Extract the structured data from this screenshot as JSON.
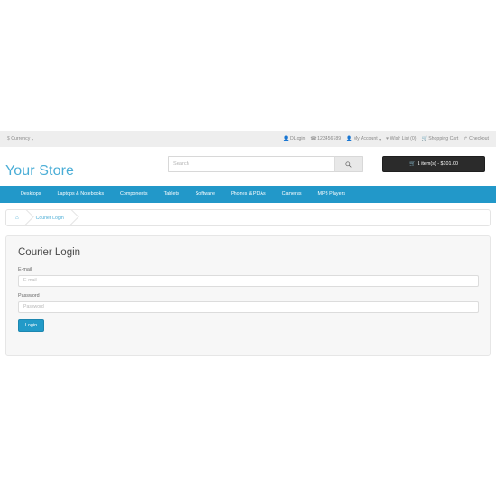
{
  "colors": {
    "brand_blue": "#2298c9",
    "logo_blue": "#4aadd6",
    "button_blue": "#229ac8",
    "topbar_gray": "#eeeeee",
    "cart_dark": "#2b2b2b",
    "panel_gray": "#f7f7f7"
  },
  "topbar": {
    "currency": {
      "symbol": "$",
      "label": "Currency",
      "caret": "▾"
    },
    "links": [
      {
        "icon": "user-icon",
        "glyph": "👤",
        "label": "DLogin"
      },
      {
        "icon": "phone-icon",
        "glyph": "☎",
        "label": "123456789"
      },
      {
        "icon": "user-icon",
        "glyph": "👤",
        "label": "My Account",
        "caret": "▾"
      },
      {
        "icon": "heart-icon",
        "glyph": "♥",
        "label": "Wish List (0)"
      },
      {
        "icon": "cart-icon",
        "glyph": "🛒",
        "label": "Shopping Cart"
      },
      {
        "icon": "arrow-right-icon",
        "glyph": "↱",
        "label": "Checkout"
      }
    ]
  },
  "header": {
    "logo": "Your Store",
    "search": {
      "placeholder": "Search",
      "value": "",
      "button_icon": "search-icon"
    },
    "cart": {
      "icon": "cart-icon",
      "glyph": "🛒",
      "label": "1 item(s) - $101.00",
      "item_count": 1,
      "total": "$101.00"
    }
  },
  "nav": {
    "items": [
      {
        "label": "Desktops"
      },
      {
        "label": "Laptops & Notebooks"
      },
      {
        "label": "Components"
      },
      {
        "label": "Tablets"
      },
      {
        "label": "Software"
      },
      {
        "label": "Phones & PDAs"
      },
      {
        "label": "Cameras"
      },
      {
        "label": "MP3 Players"
      }
    ]
  },
  "breadcrumb": {
    "home_icon": "home-icon",
    "home_glyph": "⌂",
    "items": [
      {
        "label": "Courier Login"
      }
    ]
  },
  "main": {
    "title": "Courier Login",
    "fields": [
      {
        "label": "E-mail",
        "placeholder": "E-mail",
        "value": "",
        "type": "text",
        "name": "email-field"
      },
      {
        "label": "Password",
        "placeholder": "Password",
        "value": "",
        "type": "password",
        "name": "password-field"
      }
    ],
    "submit_label": "Login"
  }
}
